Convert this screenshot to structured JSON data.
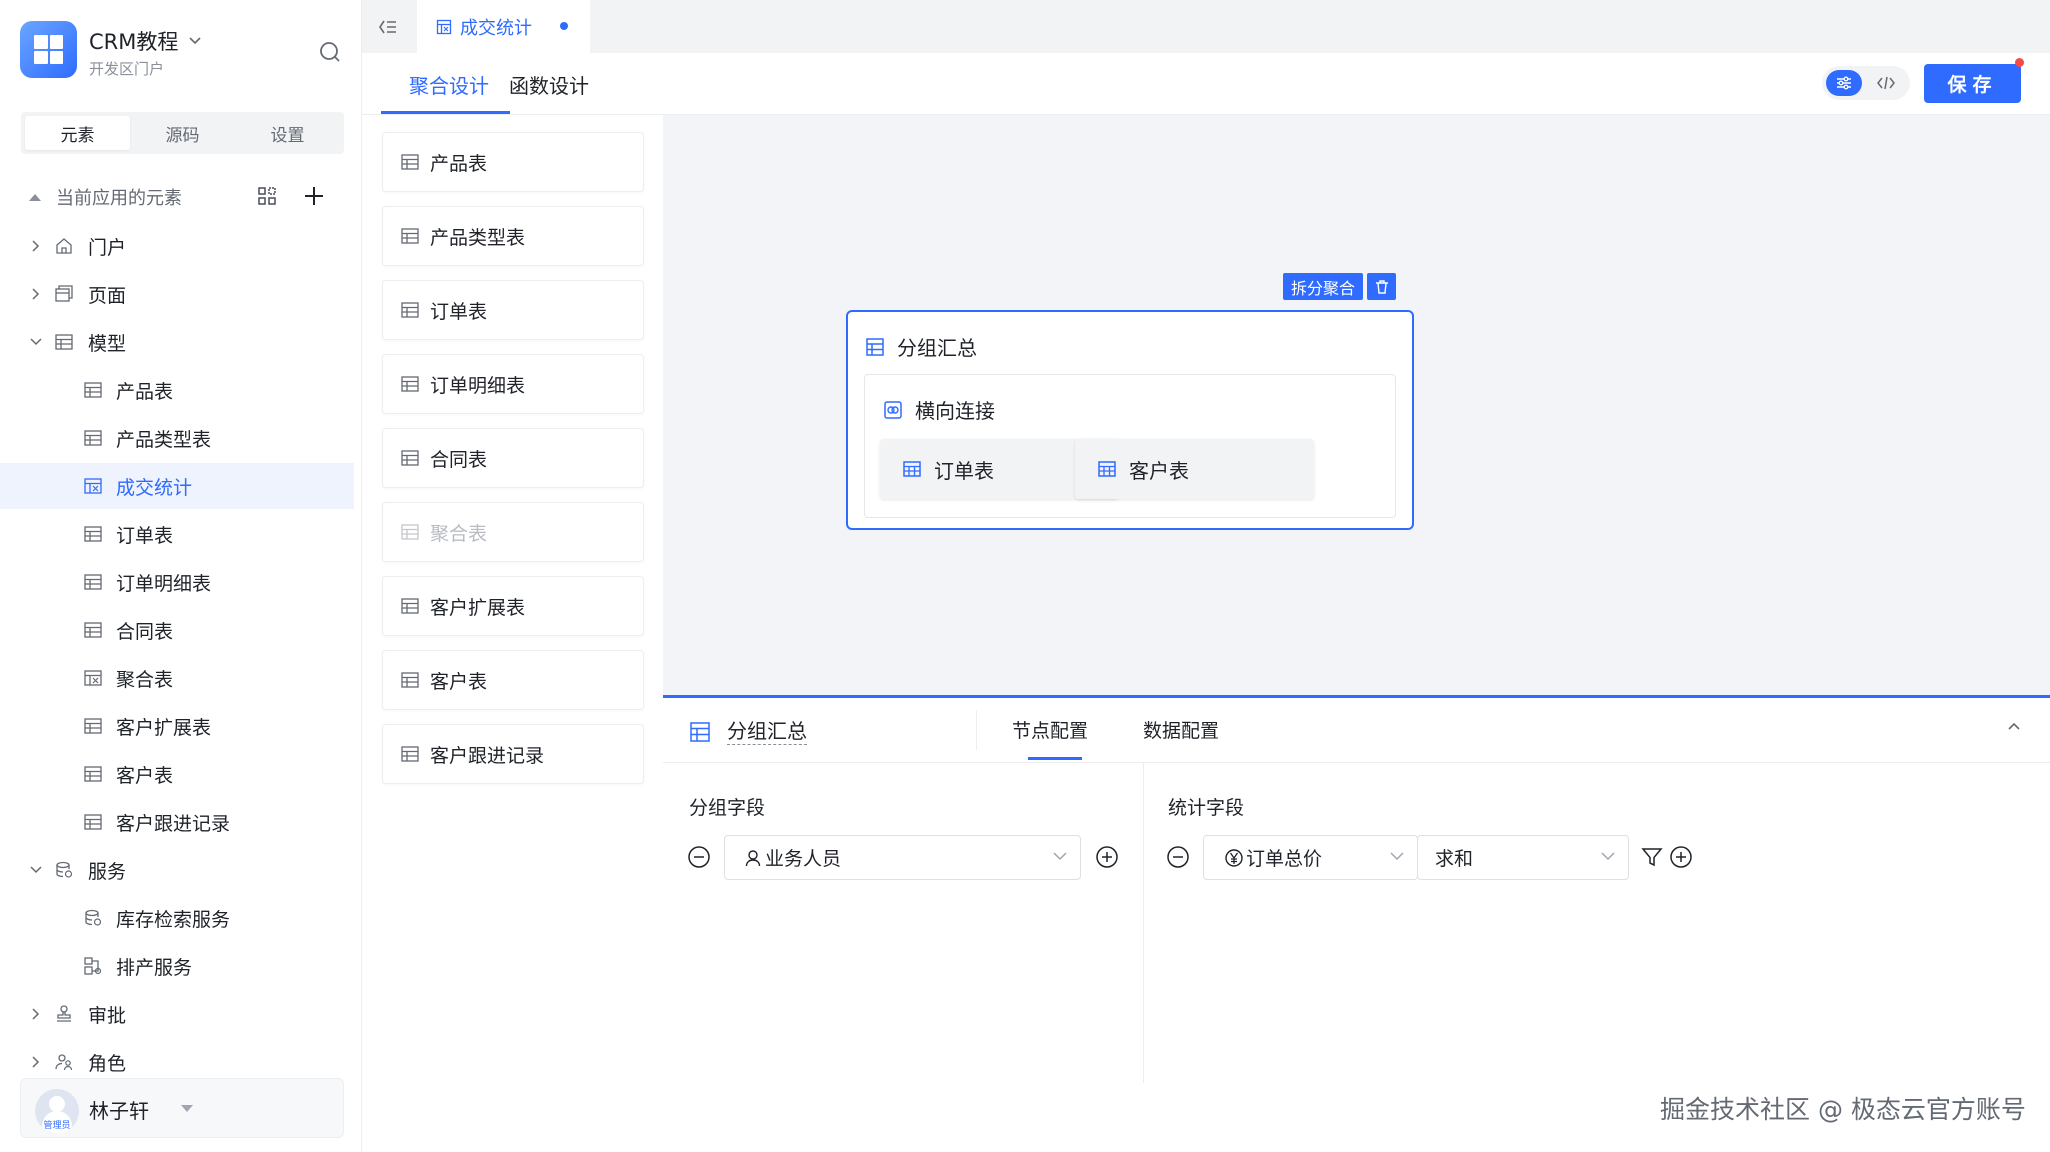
{
  "app": {
    "title": "CRM教程",
    "subtitle": "开发区门户"
  },
  "sidebar": {
    "tabs": [
      "元素",
      "源码",
      "设置"
    ],
    "active_tab": 0,
    "tree_header": "当前应用的元素",
    "tree": [
      {
        "label": "门户",
        "icon": "home-icon",
        "level": 0,
        "expand": "collapsed"
      },
      {
        "label": "页面",
        "icon": "page-icon",
        "level": 0,
        "expand": "collapsed"
      },
      {
        "label": "模型",
        "icon": "table-icon",
        "level": 0,
        "expand": "expanded"
      },
      {
        "label": "产品表",
        "icon": "table-icon",
        "level": 1
      },
      {
        "label": "产品类型表",
        "icon": "table-icon",
        "level": 1
      },
      {
        "label": "成交统计",
        "icon": "aggregate-table-icon",
        "level": 1,
        "active": true
      },
      {
        "label": "订单表",
        "icon": "table-icon",
        "level": 1
      },
      {
        "label": "订单明细表",
        "icon": "table-icon",
        "level": 1
      },
      {
        "label": "合同表",
        "icon": "table-icon",
        "level": 1
      },
      {
        "label": "聚合表",
        "icon": "aggregate-table-icon",
        "level": 1
      },
      {
        "label": "客户扩展表",
        "icon": "table-icon",
        "level": 1
      },
      {
        "label": "客户表",
        "icon": "table-icon",
        "level": 1
      },
      {
        "label": "客户跟进记录",
        "icon": "table-icon",
        "level": 1
      },
      {
        "label": "服务",
        "icon": "database-icon",
        "level": 0,
        "expand": "expanded"
      },
      {
        "label": "库存检索服务",
        "icon": "database-icon",
        "level": 1
      },
      {
        "label": "排产服务",
        "icon": "service-icon",
        "level": 1
      },
      {
        "label": "审批",
        "icon": "stamp-icon",
        "level": 0,
        "expand": "collapsed"
      },
      {
        "label": "角色",
        "icon": "users-icon",
        "level": 0,
        "expand": "collapsed"
      }
    ],
    "user": {
      "name": "林子轩",
      "role": "管理员"
    }
  },
  "topbar": {
    "tab_label": "成交统计"
  },
  "subheader": {
    "tabs": [
      "聚合设计",
      "函数设计"
    ],
    "active": 0,
    "save_label": "保存"
  },
  "table_list": [
    {
      "label": "产品表",
      "disabled": false
    },
    {
      "label": "产品类型表",
      "disabled": false
    },
    {
      "label": "订单表",
      "disabled": false
    },
    {
      "label": "订单明细表",
      "disabled": false
    },
    {
      "label": "合同表",
      "disabled": false
    },
    {
      "label": "聚合表",
      "disabled": true
    },
    {
      "label": "客户扩展表",
      "disabled": false
    },
    {
      "label": "客户表",
      "disabled": false
    },
    {
      "label": "客户跟进记录",
      "disabled": false
    }
  ],
  "canvas": {
    "node_actions": {
      "split": "拆分聚合"
    },
    "node_title": "分组汇总",
    "join_title": "横向连接",
    "join_tables": [
      "订单表",
      "客户表"
    ]
  },
  "panel": {
    "node_name": "分组汇总",
    "tabs": [
      "节点配置",
      "数据配置"
    ],
    "active_tab": 0,
    "group_label": "分组字段",
    "group_field": "业务人员",
    "stat_label": "统计字段",
    "stat_field": "订单总价",
    "stat_func": "求和"
  },
  "watermark": "掘金技术社区 @ 极态云官方账号",
  "colors": {
    "accent": "#2f6bff",
    "danger": "#f54a45",
    "canvas_bg": "#f2f4f8"
  }
}
